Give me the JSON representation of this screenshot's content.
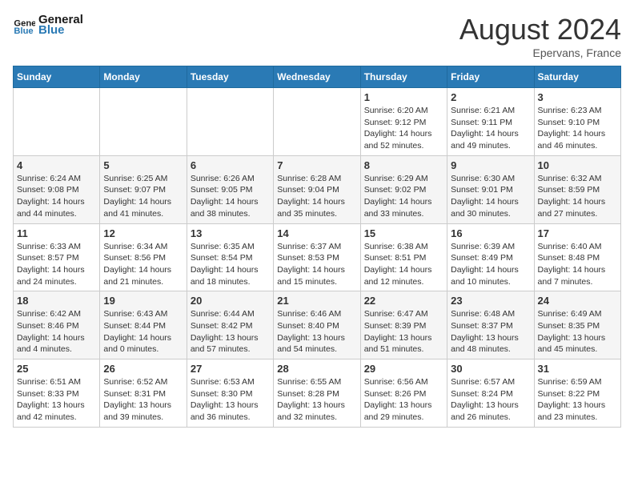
{
  "logo": {
    "text_general": "General",
    "text_blue": "Blue"
  },
  "header": {
    "month": "August 2024",
    "location": "Epervans, France"
  },
  "weekdays": [
    "Sunday",
    "Monday",
    "Tuesday",
    "Wednesday",
    "Thursday",
    "Friday",
    "Saturday"
  ],
  "weeks": [
    [
      {
        "day": "",
        "info": ""
      },
      {
        "day": "",
        "info": ""
      },
      {
        "day": "",
        "info": ""
      },
      {
        "day": "",
        "info": ""
      },
      {
        "day": "1",
        "info": "Sunrise: 6:20 AM\nSunset: 9:12 PM\nDaylight: 14 hours\nand 52 minutes."
      },
      {
        "day": "2",
        "info": "Sunrise: 6:21 AM\nSunset: 9:11 PM\nDaylight: 14 hours\nand 49 minutes."
      },
      {
        "day": "3",
        "info": "Sunrise: 6:23 AM\nSunset: 9:10 PM\nDaylight: 14 hours\nand 46 minutes."
      }
    ],
    [
      {
        "day": "4",
        "info": "Sunrise: 6:24 AM\nSunset: 9:08 PM\nDaylight: 14 hours\nand 44 minutes."
      },
      {
        "day": "5",
        "info": "Sunrise: 6:25 AM\nSunset: 9:07 PM\nDaylight: 14 hours\nand 41 minutes."
      },
      {
        "day": "6",
        "info": "Sunrise: 6:26 AM\nSunset: 9:05 PM\nDaylight: 14 hours\nand 38 minutes."
      },
      {
        "day": "7",
        "info": "Sunrise: 6:28 AM\nSunset: 9:04 PM\nDaylight: 14 hours\nand 35 minutes."
      },
      {
        "day": "8",
        "info": "Sunrise: 6:29 AM\nSunset: 9:02 PM\nDaylight: 14 hours\nand 33 minutes."
      },
      {
        "day": "9",
        "info": "Sunrise: 6:30 AM\nSunset: 9:01 PM\nDaylight: 14 hours\nand 30 minutes."
      },
      {
        "day": "10",
        "info": "Sunrise: 6:32 AM\nSunset: 8:59 PM\nDaylight: 14 hours\nand 27 minutes."
      }
    ],
    [
      {
        "day": "11",
        "info": "Sunrise: 6:33 AM\nSunset: 8:57 PM\nDaylight: 14 hours\nand 24 minutes."
      },
      {
        "day": "12",
        "info": "Sunrise: 6:34 AM\nSunset: 8:56 PM\nDaylight: 14 hours\nand 21 minutes."
      },
      {
        "day": "13",
        "info": "Sunrise: 6:35 AM\nSunset: 8:54 PM\nDaylight: 14 hours\nand 18 minutes."
      },
      {
        "day": "14",
        "info": "Sunrise: 6:37 AM\nSunset: 8:53 PM\nDaylight: 14 hours\nand 15 minutes."
      },
      {
        "day": "15",
        "info": "Sunrise: 6:38 AM\nSunset: 8:51 PM\nDaylight: 14 hours\nand 12 minutes."
      },
      {
        "day": "16",
        "info": "Sunrise: 6:39 AM\nSunset: 8:49 PM\nDaylight: 14 hours\nand 10 minutes."
      },
      {
        "day": "17",
        "info": "Sunrise: 6:40 AM\nSunset: 8:48 PM\nDaylight: 14 hours\nand 7 minutes."
      }
    ],
    [
      {
        "day": "18",
        "info": "Sunrise: 6:42 AM\nSunset: 8:46 PM\nDaylight: 14 hours\nand 4 minutes."
      },
      {
        "day": "19",
        "info": "Sunrise: 6:43 AM\nSunset: 8:44 PM\nDaylight: 14 hours\nand 0 minutes."
      },
      {
        "day": "20",
        "info": "Sunrise: 6:44 AM\nSunset: 8:42 PM\nDaylight: 13 hours\nand 57 minutes."
      },
      {
        "day": "21",
        "info": "Sunrise: 6:46 AM\nSunset: 8:40 PM\nDaylight: 13 hours\nand 54 minutes."
      },
      {
        "day": "22",
        "info": "Sunrise: 6:47 AM\nSunset: 8:39 PM\nDaylight: 13 hours\nand 51 minutes."
      },
      {
        "day": "23",
        "info": "Sunrise: 6:48 AM\nSunset: 8:37 PM\nDaylight: 13 hours\nand 48 minutes."
      },
      {
        "day": "24",
        "info": "Sunrise: 6:49 AM\nSunset: 8:35 PM\nDaylight: 13 hours\nand 45 minutes."
      }
    ],
    [
      {
        "day": "25",
        "info": "Sunrise: 6:51 AM\nSunset: 8:33 PM\nDaylight: 13 hours\nand 42 minutes."
      },
      {
        "day": "26",
        "info": "Sunrise: 6:52 AM\nSunset: 8:31 PM\nDaylight: 13 hours\nand 39 minutes."
      },
      {
        "day": "27",
        "info": "Sunrise: 6:53 AM\nSunset: 8:30 PM\nDaylight: 13 hours\nand 36 minutes."
      },
      {
        "day": "28",
        "info": "Sunrise: 6:55 AM\nSunset: 8:28 PM\nDaylight: 13 hours\nand 32 minutes."
      },
      {
        "day": "29",
        "info": "Sunrise: 6:56 AM\nSunset: 8:26 PM\nDaylight: 13 hours\nand 29 minutes."
      },
      {
        "day": "30",
        "info": "Sunrise: 6:57 AM\nSunset: 8:24 PM\nDaylight: 13 hours\nand 26 minutes."
      },
      {
        "day": "31",
        "info": "Sunrise: 6:59 AM\nSunset: 8:22 PM\nDaylight: 13 hours\nand 23 minutes."
      }
    ]
  ]
}
